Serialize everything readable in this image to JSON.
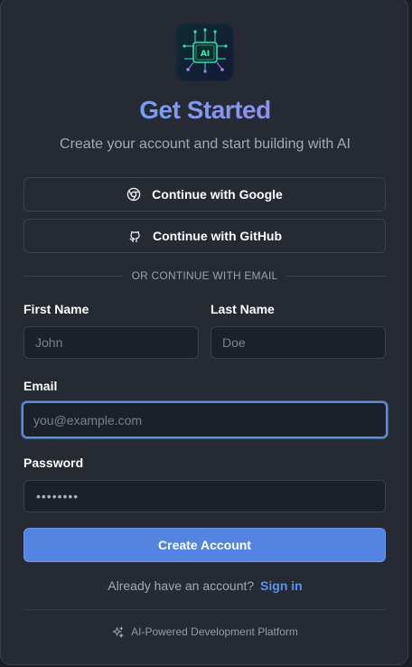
{
  "header": {
    "title": "Get Started",
    "subtitle": "Create your account and start building with AI",
    "logo_icon": "ai-chip-logo-icon"
  },
  "oauth": {
    "google_label": "Continue with Google",
    "google_icon": "chrome-icon",
    "github_label": "Continue with GitHub",
    "github_icon": "github-icon"
  },
  "divider_text": "OR CONTINUE WITH EMAIL",
  "form": {
    "first_name": {
      "label": "First Name",
      "placeholder": "John",
      "value": ""
    },
    "last_name": {
      "label": "Last Name",
      "placeholder": "Doe",
      "value": ""
    },
    "email": {
      "label": "Email",
      "placeholder": "you@example.com",
      "value": ""
    },
    "password": {
      "label": "Password",
      "masked_value": "••••••••"
    },
    "submit_label": "Create Account"
  },
  "signin": {
    "prompt": "Already have an account?",
    "link": "Sign in"
  },
  "footer": {
    "icon": "sparkles-icon",
    "text": "AI-Powered Development Platform"
  },
  "colors": {
    "accent": "#5384e1",
    "link": "#5b91ea",
    "background": "#252a33",
    "title_gradient_start": "#5ea8f3",
    "title_gradient_end": "#a583ea"
  }
}
